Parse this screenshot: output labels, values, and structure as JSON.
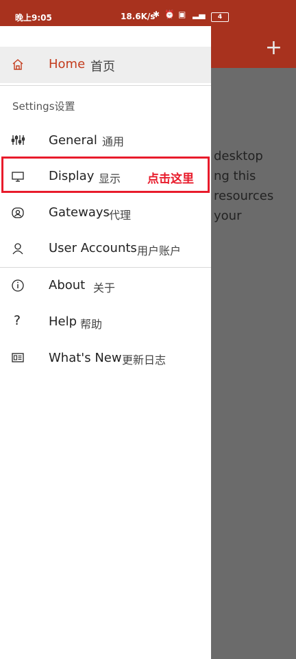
{
  "status": {
    "time": "晚上9:05",
    "speed": "18.6K/s",
    "battery": "4"
  },
  "background": {
    "partial_text": [
      "desktop",
      "ng this",
      "resources",
      "your"
    ]
  },
  "drawer": {
    "home": {
      "label": "Home",
      "zh": "首页"
    },
    "section": {
      "label": "Settings",
      "zh": "设置"
    },
    "items": [
      {
        "label": "General",
        "zh": "通用"
      },
      {
        "label": "Display",
        "zh": "显示"
      },
      {
        "label": "Gateways",
        "zh": "代理"
      },
      {
        "label": "User Accounts",
        "zh": "用户账户"
      },
      {
        "label": "About",
        "zh": "关于"
      },
      {
        "label": "Help",
        "zh": "帮助"
      },
      {
        "label": "What's New",
        "zh": "更新日志"
      }
    ],
    "annotation": "点击这里"
  },
  "colors": {
    "accent": "#c33b1c",
    "appbar": "#a8321e",
    "highlight": "#e81b2b"
  }
}
